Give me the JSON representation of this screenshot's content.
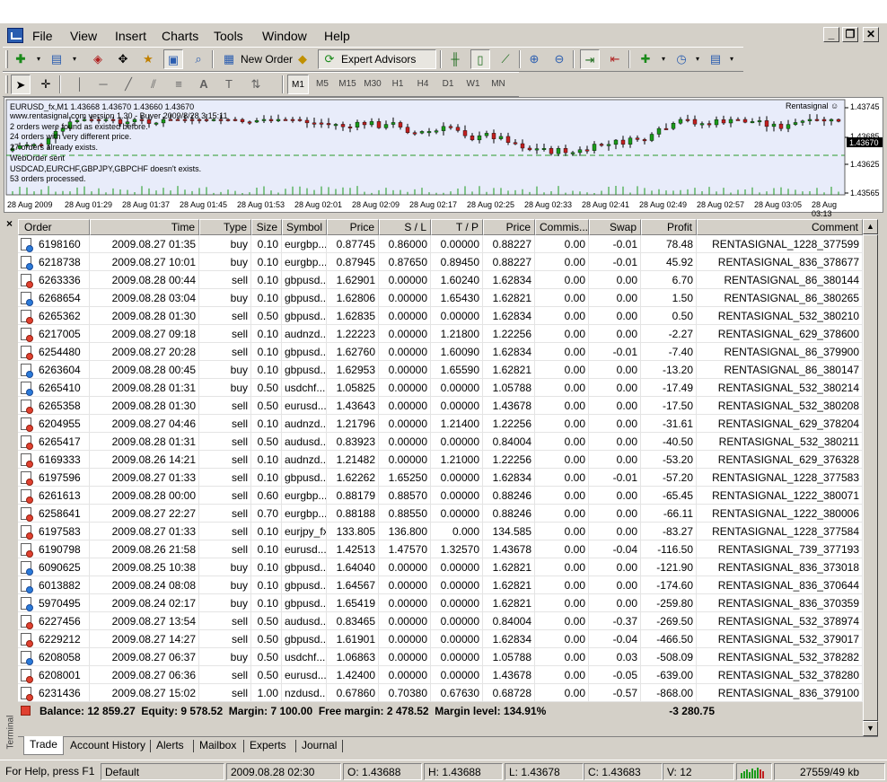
{
  "menu": [
    "File",
    "View",
    "Insert",
    "Charts",
    "Tools",
    "Window",
    "Help"
  ],
  "toolbar": {
    "new_order": "New Order",
    "expert_advisors": "Expert Advisors",
    "timeframes": [
      "M1",
      "M5",
      "M15",
      "M30",
      "H1",
      "H4",
      "D1",
      "W1",
      "MN"
    ]
  },
  "chart": {
    "header_line": "EURUSD_fx,M1  1.43668 1.43670 1.43660 1.43670",
    "log_lines": [
      "www.rentasignal.com version 1.30 - Buyer 2009/8/28 3:15:11",
      "2 orders were found as existed before.",
      "24 orders with very different price.",
      "27 orders already exists.",
      "WebOrder sent",
      "USDCAD,EURCHF,GBPJPY,GBPCHF doesn't exists.",
      "53 orders processed."
    ],
    "brand": "Rentasignal ☺",
    "price_labels": [
      "1.43745",
      "1.43685",
      "1.43670",
      "1.43625",
      "1.43565"
    ],
    "current_price": "1.43670",
    "time_labels": [
      "28 Aug 2009",
      "28 Aug 01:29",
      "28 Aug 01:37",
      "28 Aug 01:45",
      "28 Aug 01:53",
      "28 Aug 02:01",
      "28 Aug 02:09",
      "28 Aug 02:17",
      "28 Aug 02:25",
      "28 Aug 02:33",
      "28 Aug 02:41",
      "28 Aug 02:49",
      "28 Aug 02:57",
      "28 Aug 03:05",
      "28 Aug 03:13"
    ]
  },
  "columns": [
    "Order",
    "Time",
    "Type",
    "Size",
    "Symbol",
    "Price",
    "S / L",
    "T / P",
    "Price",
    "Commis...",
    "Swap",
    "Profit",
    "Comment"
  ],
  "orders": [
    [
      "6198160",
      "2009.08.27 01:35",
      "buy",
      "0.10",
      "eurgbp...",
      "0.87745",
      "0.86000",
      "0.00000",
      "0.88227",
      "0.00",
      "-0.01",
      "78.48",
      "RENTASIGNAL_1228_377599"
    ],
    [
      "6218738",
      "2009.08.27 10:01",
      "buy",
      "0.10",
      "eurgbp...",
      "0.87945",
      "0.87650",
      "0.89450",
      "0.88227",
      "0.00",
      "-0.01",
      "45.92",
      "RENTASIGNAL_836_378677"
    ],
    [
      "6263336",
      "2009.08.28 00:44",
      "sell",
      "0.10",
      "gbpusd...",
      "1.62901",
      "0.00000",
      "1.60240",
      "1.62834",
      "0.00",
      "0.00",
      "6.70",
      "RENTASIGNAL_86_380144"
    ],
    [
      "6268654",
      "2009.08.28 03:04",
      "buy",
      "0.10",
      "gbpusd...",
      "1.62806",
      "0.00000",
      "1.65430",
      "1.62821",
      "0.00",
      "0.00",
      "1.50",
      "RENTASIGNAL_86_380265"
    ],
    [
      "6265362",
      "2009.08.28 01:30",
      "sell",
      "0.50",
      "gbpusd...",
      "1.62835",
      "0.00000",
      "0.00000",
      "1.62834",
      "0.00",
      "0.00",
      "0.50",
      "RENTASIGNAL_532_380210"
    ],
    [
      "6217005",
      "2009.08.27 09:18",
      "sell",
      "0.10",
      "audnzd...",
      "1.22223",
      "0.00000",
      "1.21800",
      "1.22256",
      "0.00",
      "0.00",
      "-2.27",
      "RENTASIGNAL_629_378600"
    ],
    [
      "6254480",
      "2009.08.27 20:28",
      "sell",
      "0.10",
      "gbpusd...",
      "1.62760",
      "0.00000",
      "1.60090",
      "1.62834",
      "0.00",
      "-0.01",
      "-7.40",
      "RENTASIGNAL_86_379900"
    ],
    [
      "6263604",
      "2009.08.28 00:45",
      "buy",
      "0.10",
      "gbpusd...",
      "1.62953",
      "0.00000",
      "1.65590",
      "1.62821",
      "0.00",
      "0.00",
      "-13.20",
      "RENTASIGNAL_86_380147"
    ],
    [
      "6265410",
      "2009.08.28 01:31",
      "buy",
      "0.50",
      "usdchf...",
      "1.05825",
      "0.00000",
      "0.00000",
      "1.05788",
      "0.00",
      "0.00",
      "-17.49",
      "RENTASIGNAL_532_380214"
    ],
    [
      "6265358",
      "2009.08.28 01:30",
      "sell",
      "0.50",
      "eurusd...",
      "1.43643",
      "0.00000",
      "0.00000",
      "1.43678",
      "0.00",
      "0.00",
      "-17.50",
      "RENTASIGNAL_532_380208"
    ],
    [
      "6204955",
      "2009.08.27 04:46",
      "sell",
      "0.10",
      "audnzd...",
      "1.21796",
      "0.00000",
      "1.21400",
      "1.22256",
      "0.00",
      "0.00",
      "-31.61",
      "RENTASIGNAL_629_378204"
    ],
    [
      "6265417",
      "2009.08.28 01:31",
      "sell",
      "0.50",
      "audusd...",
      "0.83923",
      "0.00000",
      "0.00000",
      "0.84004",
      "0.00",
      "0.00",
      "-40.50",
      "RENTASIGNAL_532_380211"
    ],
    [
      "6169333",
      "2009.08.26 14:21",
      "sell",
      "0.10",
      "audnzd...",
      "1.21482",
      "0.00000",
      "1.21000",
      "1.22256",
      "0.00",
      "0.00",
      "-53.20",
      "RENTASIGNAL_629_376328"
    ],
    [
      "6197596",
      "2009.08.27 01:33",
      "sell",
      "0.10",
      "gbpusd...",
      "1.62262",
      "1.65250",
      "0.00000",
      "1.62834",
      "0.00",
      "-0.01",
      "-57.20",
      "RENTASIGNAL_1228_377583"
    ],
    [
      "6261613",
      "2009.08.28 00:00",
      "sell",
      "0.60",
      "eurgbp...",
      "0.88179",
      "0.88570",
      "0.00000",
      "0.88246",
      "0.00",
      "0.00",
      "-65.45",
      "RENTASIGNAL_1222_380071"
    ],
    [
      "6258641",
      "2009.08.27 22:27",
      "sell",
      "0.70",
      "eurgbp...",
      "0.88188",
      "0.88550",
      "0.00000",
      "0.88246",
      "0.00",
      "0.00",
      "-66.11",
      "RENTASIGNAL_1222_380006"
    ],
    [
      "6197583",
      "2009.08.27 01:33",
      "sell",
      "0.10",
      "eurjpy_fx",
      "133.805",
      "136.800",
      "0.000",
      "134.585",
      "0.00",
      "0.00",
      "-83.27",
      "RENTASIGNAL_1228_377584"
    ],
    [
      "6190798",
      "2009.08.26 21:58",
      "sell",
      "0.10",
      "eurusd...",
      "1.42513",
      "1.47570",
      "1.32570",
      "1.43678",
      "0.00",
      "-0.04",
      "-116.50",
      "RENTASIGNAL_739_377193"
    ],
    [
      "6090625",
      "2009.08.25 10:38",
      "buy",
      "0.10",
      "gbpusd...",
      "1.64040",
      "0.00000",
      "0.00000",
      "1.62821",
      "0.00",
      "0.00",
      "-121.90",
      "RENTASIGNAL_836_373018"
    ],
    [
      "6013882",
      "2009.08.24 08:08",
      "buy",
      "0.10",
      "gbpusd...",
      "1.64567",
      "0.00000",
      "0.00000",
      "1.62821",
      "0.00",
      "0.00",
      "-174.60",
      "RENTASIGNAL_836_370644"
    ],
    [
      "5970495",
      "2009.08.24 02:17",
      "buy",
      "0.10",
      "gbpusd...",
      "1.65419",
      "0.00000",
      "0.00000",
      "1.62821",
      "0.00",
      "0.00",
      "-259.80",
      "RENTASIGNAL_836_370359"
    ],
    [
      "6227456",
      "2009.08.27 13:54",
      "sell",
      "0.50",
      "audusd...",
      "0.83465",
      "0.00000",
      "0.00000",
      "0.84004",
      "0.00",
      "-0.37",
      "-269.50",
      "RENTASIGNAL_532_378974"
    ],
    [
      "6229212",
      "2009.08.27 14:27",
      "sell",
      "0.50",
      "gbpusd...",
      "1.61901",
      "0.00000",
      "0.00000",
      "1.62834",
      "0.00",
      "-0.04",
      "-466.50",
      "RENTASIGNAL_532_379017"
    ],
    [
      "6208058",
      "2009.08.27 06:37",
      "buy",
      "0.50",
      "usdchf...",
      "1.06863",
      "0.00000",
      "0.00000",
      "1.05788",
      "0.00",
      "0.03",
      "-508.09",
      "RENTASIGNAL_532_378282"
    ],
    [
      "6208001",
      "2009.08.27 06:36",
      "sell",
      "0.50",
      "eurusd...",
      "1.42400",
      "0.00000",
      "0.00000",
      "1.43678",
      "0.00",
      "-0.05",
      "-639.00",
      "RENTASIGNAL_532_378280"
    ],
    [
      "6231436",
      "2009.08.27 15:02",
      "sell",
      "1.00",
      "nzdusd...",
      "0.67860",
      "0.70380",
      "0.67630",
      "0.68728",
      "0.00",
      "-0.57",
      "-868.00",
      "RENTASIGNAL_836_379100"
    ]
  ],
  "balance": {
    "summary": "Balance: 12 859.27  Equity: 9 578.52  Margin: 7 100.00  Free margin: 2 478.52  Margin level: 134.91%",
    "total_profit": "-3 280.75"
  },
  "terminal_label": "Terminal",
  "tabs": [
    "Trade",
    "Account History",
    "Alerts",
    "Mailbox",
    "Experts",
    "Journal"
  ],
  "status": {
    "help": "For Help, press F1",
    "profile": "Default",
    "time": "2009.08.28 02:30",
    "open": "O: 1.43688",
    "high": "H: 1.43688",
    "low": "L: 1.43678",
    "close": "C: 1.43683",
    "volume": "V: 12",
    "traffic": "27559/49 kb"
  }
}
